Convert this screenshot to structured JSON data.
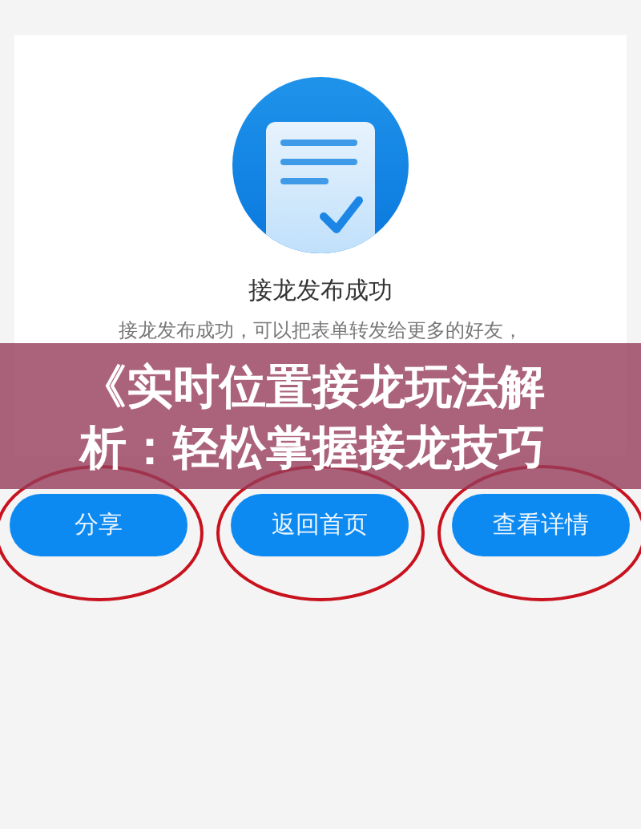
{
  "card": {
    "title": "接龙发布成功",
    "message": "接龙发布成功，可以把表单转发给更多的好友，"
  },
  "buttons": [
    {
      "label": "分享",
      "circled": true
    },
    {
      "label": "返回首页",
      "circled": true
    },
    {
      "label": "查看详情",
      "circled": true
    }
  ],
  "banner": {
    "title": "《实时位置接龙玩法解析：轻松掌握接龙技巧"
  }
}
